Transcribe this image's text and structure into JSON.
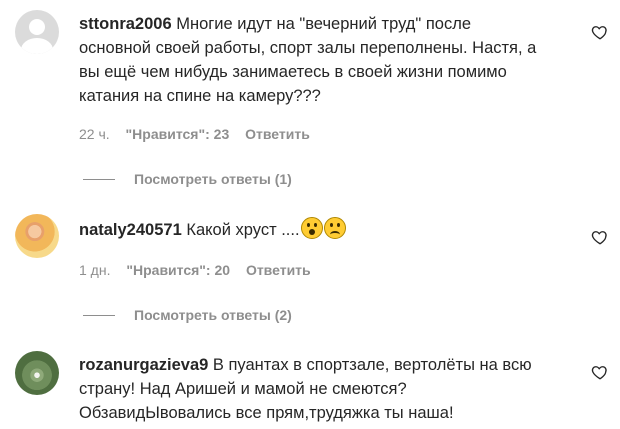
{
  "comments": [
    {
      "username": "sttonra2006",
      "text": "Многие идут на \"вечерний труд\" после\nосновной своей работы, спорт залы переполнены. Настя, а\nвы ещё чем нибудь занимаетесь в своей жизни помимо\nкатания на спине на камеру???",
      "time": "22 ч.",
      "likes": "\"Нравится\": 23",
      "reply_label": "Ответить",
      "view_replies": "Посмотреть ответы (1)",
      "avatar": "default-avatar-icon"
    },
    {
      "username": "nataly240571",
      "text": "Какой хруст ....",
      "emojis": [
        "astonished-face-emoji",
        "sad-face-emoji"
      ],
      "time": "1 дн.",
      "likes": "\"Нравится\": 20",
      "reply_label": "Ответить",
      "view_replies": "Посмотреть ответы (2)",
      "avatar": "profile-photo"
    },
    {
      "username": "rozanurgazieva9",
      "text": "В пуантах в спортзале, вертолёты на всю\nстрану! Над Аришей и мамой не смеются?\nОбзавидЫвовались все прям,трудяжка ты наша!",
      "avatar": "profile-photo"
    }
  ],
  "icons": {
    "like": "heart-outline-icon"
  },
  "colors": {
    "text": "#262626",
    "secondary": "#8e8e8e",
    "background": "#ffffff"
  }
}
